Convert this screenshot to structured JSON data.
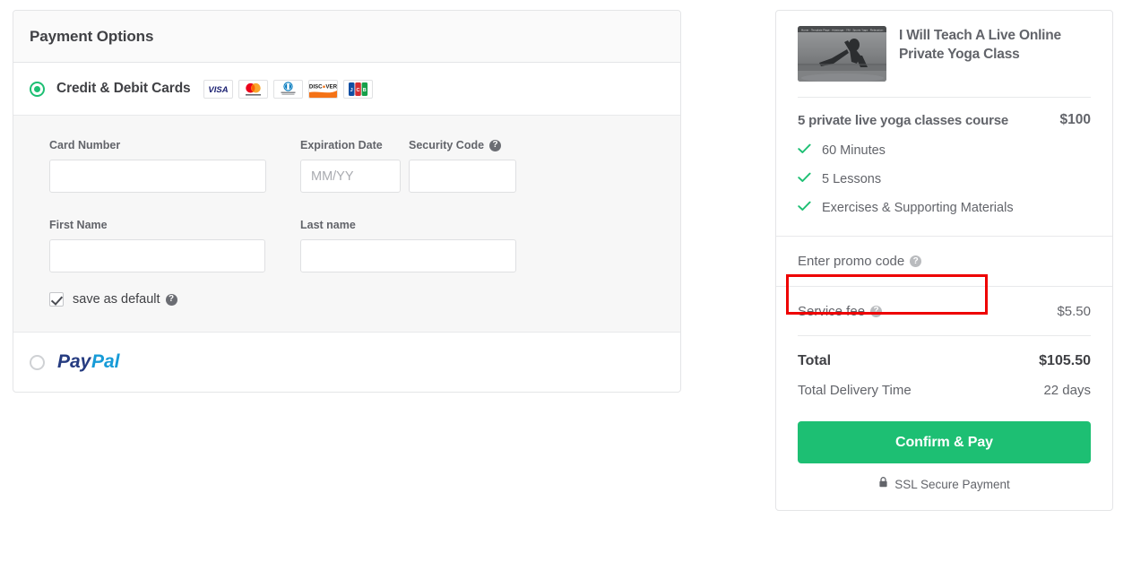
{
  "payment_panel": {
    "header_title": "Payment Options",
    "methods": [
      {
        "id": "card",
        "label": "Credit & Debit Cards",
        "selected": true,
        "brands": [
          "visa-logo",
          "mastercard-logo",
          "diners-club-logo",
          "discover-logo",
          "jcb-logo"
        ]
      },
      {
        "id": "paypal",
        "label": "PayPal",
        "selected": false,
        "logo_parts": {
          "first": "Pay",
          "second": "Pal"
        }
      }
    ],
    "card_form": {
      "card_number": {
        "label": "Card Number",
        "value": "",
        "placeholder": ""
      },
      "expiration_date": {
        "label": "Expiration Date",
        "value": "",
        "placeholder": "MM/YY"
      },
      "security_code": {
        "label": "Security Code",
        "value": "",
        "placeholder": "",
        "help_icon": "question-mark-icon"
      },
      "first_name": {
        "label": "First Name",
        "value": "",
        "placeholder": ""
      },
      "last_name": {
        "label": "Last name",
        "value": "",
        "placeholder": ""
      },
      "save_default": {
        "label": "save as default",
        "checked": true,
        "help_icon": "question-mark-icon"
      }
    }
  },
  "summary_panel": {
    "gig_title": "I Will Teach A Live Online Private Yoga Class",
    "thumbnail": "yoga-pose-photo",
    "package": {
      "name": "5 private live yoga classes course",
      "price": "$100",
      "features": [
        "60 Minutes",
        "5 Lessons",
        "Exercises & Supporting Materials"
      ]
    },
    "promo": {
      "label": "Enter promo code",
      "help_icon": "question-mark-icon"
    },
    "service_fee": {
      "label": "Service fee",
      "value": "$5.50",
      "help_icon": "question-mark-icon"
    },
    "total": {
      "label": "Total",
      "value": "$105.50"
    },
    "delivery": {
      "label": "Total Delivery Time",
      "value": "22 days"
    },
    "confirm_button": "Confirm & Pay",
    "ssl": {
      "label": "SSL Secure Payment",
      "icon": "lock-icon"
    }
  },
  "colors": {
    "accent_green": "#1dbf73",
    "annotation_red": "#ee0000",
    "text_dark": "#404145",
    "text_gray": "#62646a"
  }
}
